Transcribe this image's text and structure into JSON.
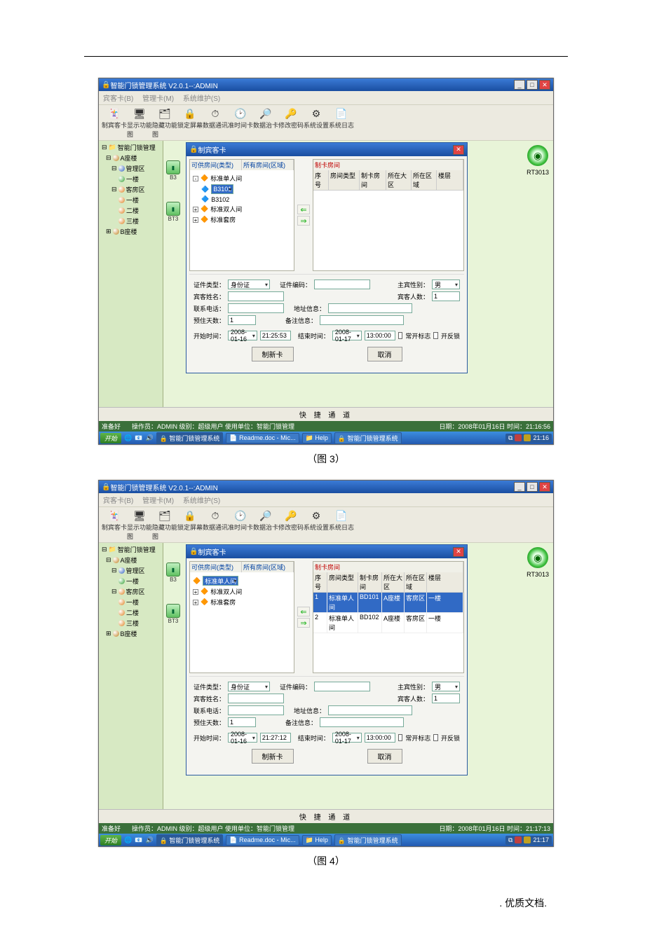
{
  "menu": {
    "m1": "宾客卡(B)",
    "m2": "管理卡(M)",
    "m3": "系统维护(S)"
  },
  "toolbar": [
    {
      "icon": "🃏",
      "label": "制宾客卡"
    },
    {
      "icon": "🖥",
      "label": "显示功能图"
    },
    {
      "icon": "🗂",
      "label": "隐藏功能图"
    },
    {
      "icon": "🔒",
      "label": "锁定屏幕"
    },
    {
      "icon": "⏱",
      "label": "数据通讯"
    },
    {
      "icon": "🕑",
      "label": "准时间卡"
    },
    {
      "icon": "🔎",
      "label": "数据治卡"
    },
    {
      "icon": "🔑",
      "label": "修改密码"
    },
    {
      "icon": "⚙",
      "label": "系统设置"
    },
    {
      "icon": "📄",
      "label": "系统日志"
    }
  ],
  "tree": {
    "root": "智能门锁管理",
    "a_building": "A座楼",
    "manage_area": "管理区",
    "floor1": "一楼",
    "guest_area": "客房区",
    "f1": "一楼",
    "f2": "二楼",
    "f3": "三楼",
    "b_building": "B座楼"
  },
  "device": {
    "b3": "B3",
    "bt3": "BT3",
    "rt3013": "RT3013"
  },
  "modal": {
    "title": "制宾客卡",
    "avail_by_type": "可供房间(类型)",
    "avail_by_area": "所有房间(区域)",
    "make_card_room": "制卡房间",
    "grid": {
      "head": [
        "序号",
        "房间类型",
        "制卡房间",
        "所在大区",
        "所在区域",
        "楼层"
      ],
      "rows": [
        [
          "1",
          "标准单人间",
          "BD101",
          "A座楼",
          "客房区",
          "一楼"
        ],
        [
          "2",
          "标准单人间",
          "BD102",
          "A座楼",
          "客房区",
          "一楼"
        ]
      ]
    },
    "roomTree": {
      "std_single": "标准单人间",
      "b3101": "B3101",
      "b3102": "B3102",
      "std_double": "标准双人间",
      "std_suite": "标准套房"
    },
    "form": {
      "id_type_lbl": "证件类型：",
      "id_type_val": "身份证",
      "id_no_lbl": "证件编码：",
      "host_sex_lbl": "主宾性别：",
      "host_sex_val": "男",
      "guest_name_lbl": "宾客姓名：",
      "guest_count_lbl": "宾客人数：",
      "guest_count_val": "1",
      "phone_lbl": "联系电话：",
      "addr_lbl": "地址信息：",
      "pre_days_lbl": "预住天数：",
      "pre_days_val": "1",
      "note_lbl": "备注信息：",
      "open_time_lbl": "开始时间：",
      "open_date_val": "2008-01-16",
      "open_time_val": "21:25:53",
      "open_time_val2": "21:27:12",
      "end_time_lbl": "结束时间：",
      "end_date_val": "2008-01-17",
      "end_time_val": "13:00:00",
      "chk_often": "常开标志",
      "chk_antilock": "开反锁",
      "btn_make": "制新卡",
      "btn_cancel": "取消"
    }
  },
  "quick": "快 捷 通 道",
  "status": {
    "ready": "准备好",
    "operator": "操作员：ADMIN 级别：超级用户    使用单位：智能门锁管理",
    "date1": "日期：2008年01月16日 时间：21:16:56",
    "date2": "日期：2008年01月16日 时间：21:17:13"
  },
  "taskbar": {
    "start": "开始",
    "t1": "智能门锁管理系统",
    "t2": "Readme.doc - Mic...",
    "t3": "Help",
    "t4": "智能门锁管理系统",
    "time1": "21:16",
    "time2": "21:17"
  },
  "title": "智能门锁管理系统  V2.0.1--:ADMIN",
  "caption3": "（图 3）",
  "caption4": "（图 4）",
  "footer": ". 优质文档."
}
